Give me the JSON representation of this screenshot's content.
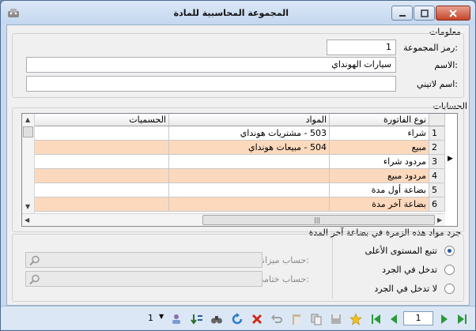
{
  "window": {
    "title": "المجموعة المحاسبية للمادة"
  },
  "info": {
    "section_label": "معلومات",
    "group_code_label": "رمز المجموعة:",
    "group_code_value": "1",
    "name_label": "الاسم:",
    "name_value": "سيارات الهونداي",
    "latin_name_label": "اسم لاتيني:",
    "latin_name_value": ""
  },
  "accounts": {
    "section_label": "الحسابات",
    "columns": [
      "نوع الفاتورة",
      "المواد",
      "الحسميات"
    ],
    "rows": [
      {
        "num": "1",
        "type": "شراء",
        "materials": "503 - مشتريات هونداي",
        "discounts": ""
      },
      {
        "num": "2",
        "type": "مبيع",
        "materials": "504 - مبيعات هونداي",
        "discounts": ""
      },
      {
        "num": "3",
        "type": "مردود شراء",
        "materials": "",
        "discounts": ""
      },
      {
        "num": "4",
        "type": "مردود مبيع",
        "materials": "",
        "discounts": ""
      },
      {
        "num": "5",
        "type": "بضاعة أول مدة",
        "materials": "",
        "discounts": ""
      },
      {
        "num": "6",
        "type": "بضاعة آخر مدة",
        "materials": "",
        "discounts": ""
      }
    ],
    "current_row": 3
  },
  "inventory": {
    "section_label": "جرد مواد هذه الزمرة في بضاعة آخر المدة",
    "options": [
      {
        "label": "تتبع المستوى الأعلى",
        "checked": true
      },
      {
        "label": "تدخل في الجرد",
        "checked": false
      },
      {
        "label": "لا تدخل في الجرد",
        "checked": false
      }
    ],
    "budget_account_label": "حساب ميزانية:",
    "final_account_label": "حساب ختامي:"
  },
  "toolbar": {
    "page_value": "1",
    "left_value": "1"
  },
  "colors": {
    "alt_row": "#fcd9bd",
    "title_bg": "#c9daf0"
  }
}
